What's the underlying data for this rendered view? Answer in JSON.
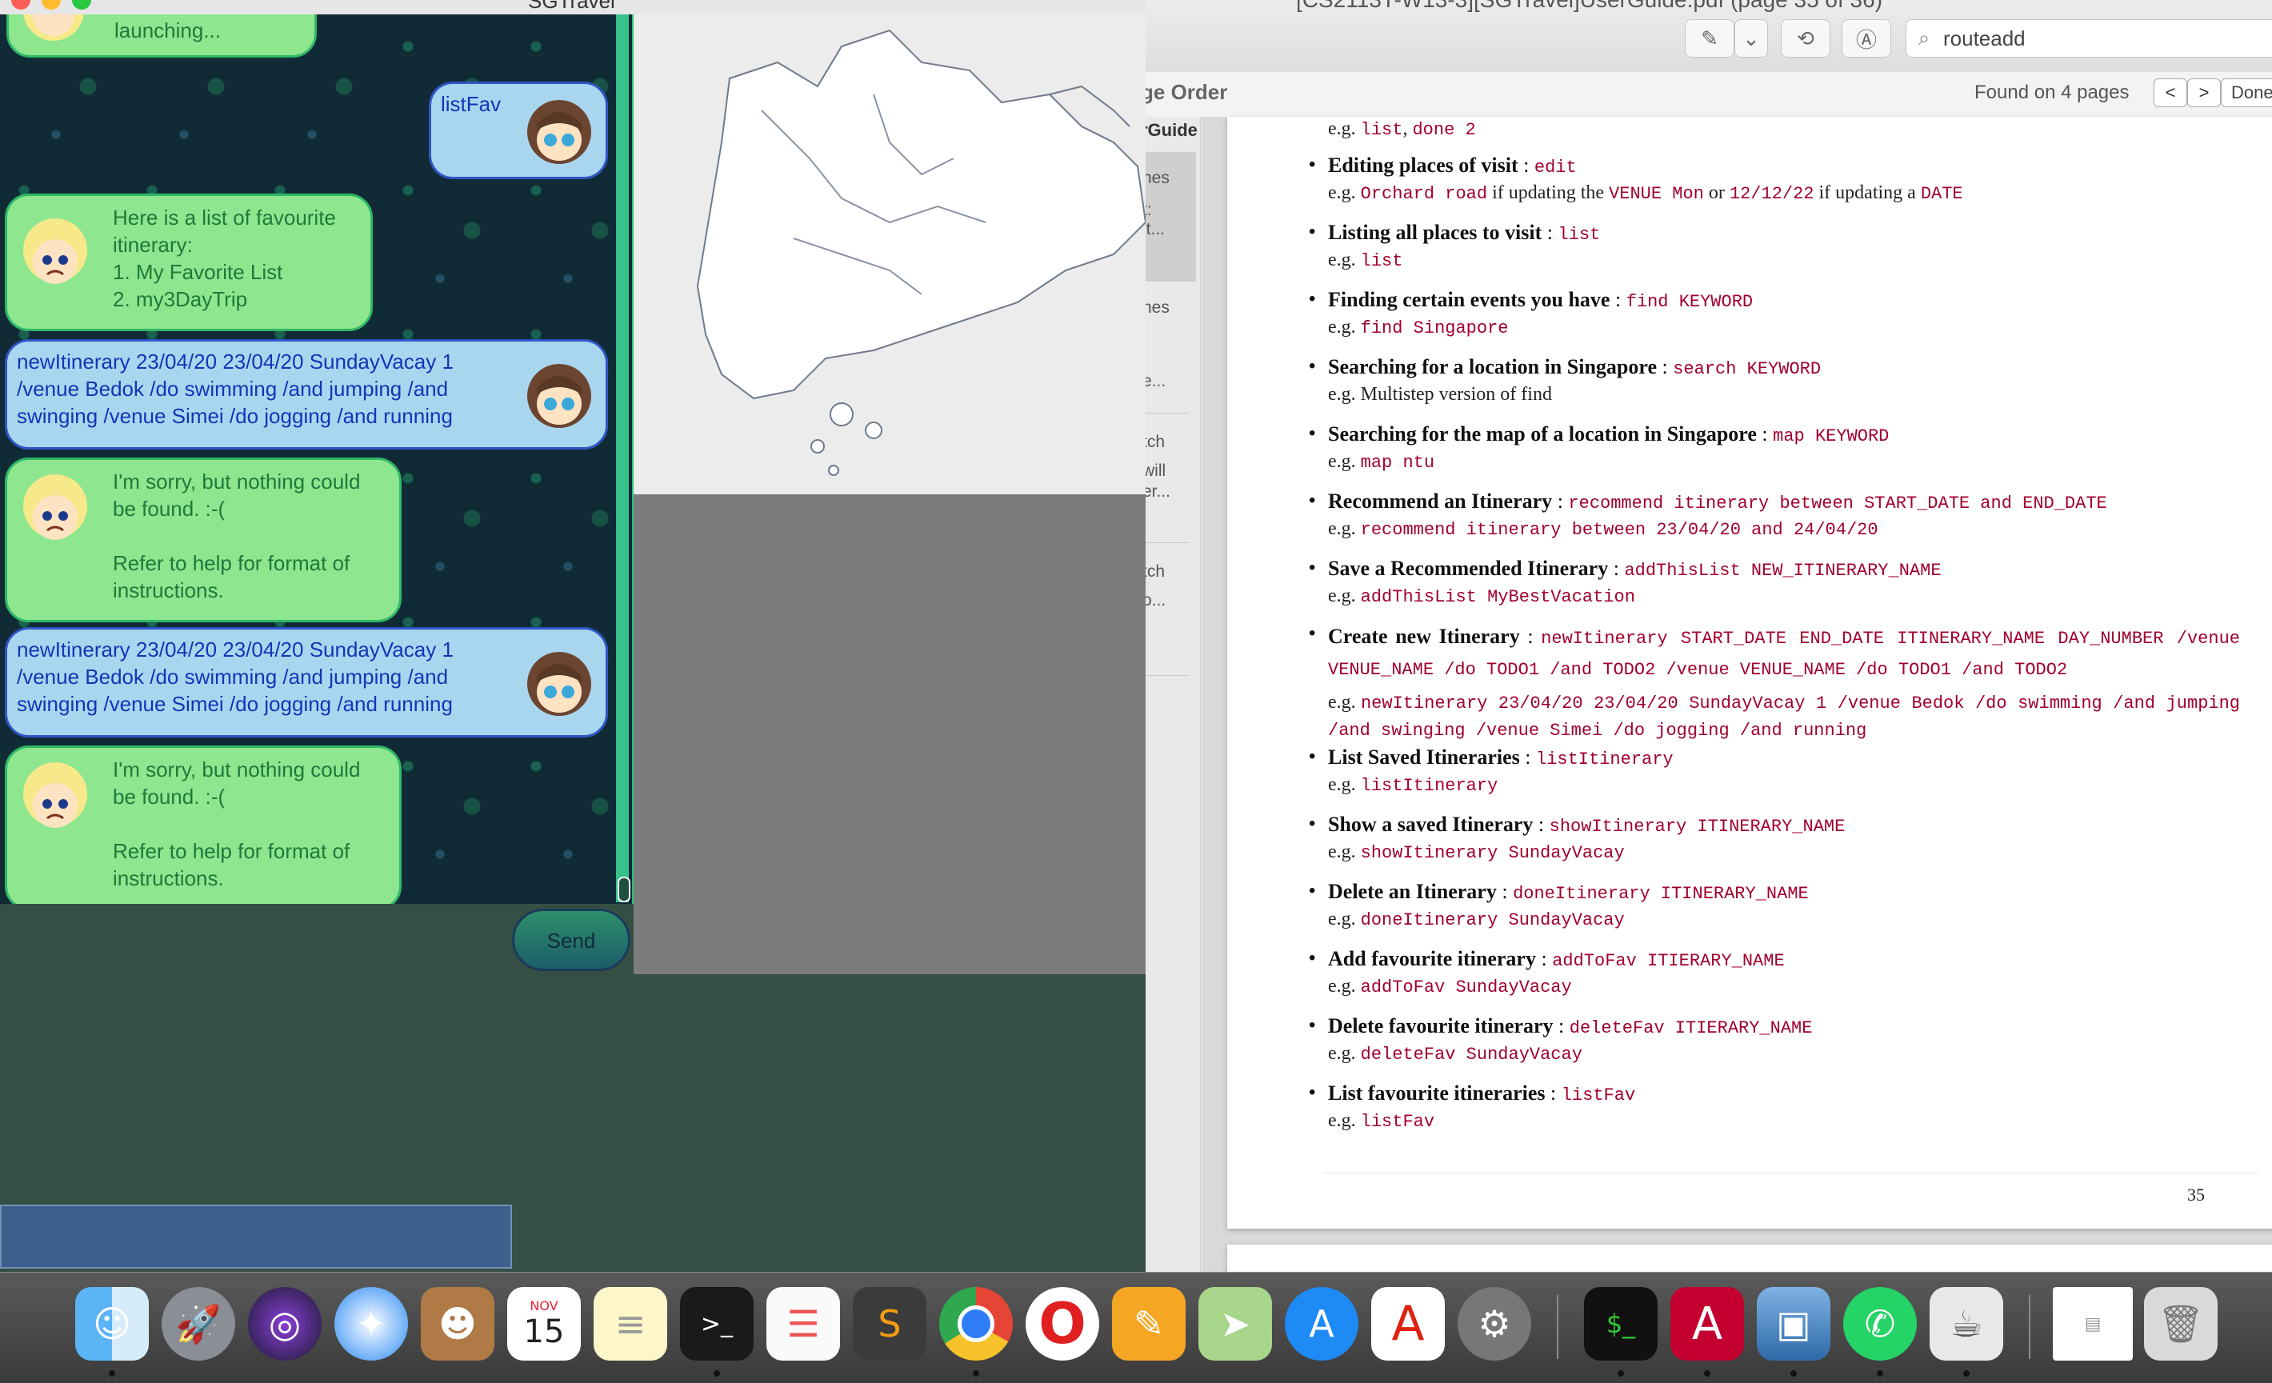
{
  "preview": {
    "window_title": "[CS2113T-W13-3][SGTravel]UserGuide.pdf (page 35 of 36)",
    "search": {
      "value": "routeadd",
      "icon": "magnifier-icon"
    },
    "find_bar": {
      "sort_title": "ge Order",
      "found_text": "Found on 4 pages",
      "prev_label": "<",
      "next_label": ">",
      "done_label": "Done"
    },
    "sidebar": {
      "title": "rGuide",
      "hits": [
        "nes",
        "t:",
        "it...",
        "nes",
        "e...",
        "tch",
        "will",
        "er...",
        "tch",
        "o..."
      ]
    },
    "page_number": "35",
    "items": [
      {
        "head": "",
        "head_cmd": "",
        "ex_prefix": "e.g.",
        "ex_code": "list",
        "ex_text": ", ",
        "ex_code2": "done 2"
      },
      {
        "head": "Editing places of visit",
        "head_cmd": "edit",
        "ex_prefix": "e.g.",
        "ex_code": "Orchard road",
        "ex_text": " if updating the ",
        "ex_code2": "VENUE Mon",
        "ex_text2": " or ",
        "ex_code3": "12/12/22",
        "ex_text3": " if updating a ",
        "ex_code4": "DATE"
      },
      {
        "head": "Listing all places to visit",
        "head_cmd": "list",
        "ex_prefix": "e.g.",
        "ex_code": "list"
      },
      {
        "head": "Finding certain events you have",
        "head_cmd": "find KEYWORD",
        "ex_prefix": "e.g.",
        "ex_code": "find Singapore"
      },
      {
        "head": "Searching for a location in Singapore",
        "head_cmd": "search KEYWORD",
        "ex_prefix": "e.g. Multistep version of find"
      },
      {
        "head": "Searching for the map of a location in Singapore",
        "head_cmd": "map KEYWORD",
        "ex_prefix": "e.g.",
        "ex_code": "map ntu"
      },
      {
        "head": "Recommend an Itinerary",
        "head_cmd": "recommend itinerary between START_DATE and END_DATE",
        "ex_prefix": "e.g.",
        "ex_code": "recommend itinerary between 23/04/20 and 24/04/20"
      },
      {
        "head": "Save a Recommended Itinerary",
        "head_cmd": "addThisList NEW_ITINERARY_NAME",
        "ex_prefix": "e.g.",
        "ex_code": "addThisList MyBestVacation"
      },
      {
        "head": "Create new Itinerary",
        "head_cmd": "newItinerary START_DATE END_DATE ITINERARY_NAME DAY_NUMBER /venue VENUE_NAME /do TODO1 /and TODO2 /venue VENUE_NAME /do TODO1 /and TODO2",
        "ex_prefix": "e.g.",
        "ex_code": "newItinerary 23/04/20 23/04/20 SundayVacay 1 /venue Bedok /do swimming /and jumping /and swinging /venue Simei /do jogging /and running"
      },
      {
        "head": "List Saved Itineraries",
        "head_cmd": "listItinerary",
        "ex_prefix": "e.g.",
        "ex_code": "listItinerary"
      },
      {
        "head": "Show a saved Itinerary",
        "head_cmd": "showItinerary ITINERARY_NAME",
        "ex_prefix": "e.g.",
        "ex_code": "showItinerary SundayVacay"
      },
      {
        "head": "Delete an Itinerary",
        "head_cmd": "doneItinerary ITINERARY_NAME",
        "ex_prefix": "e.g.",
        "ex_code": "doneItinerary SundayVacay"
      },
      {
        "head": "Add favourite itinerary",
        "head_cmd": "addToFav ITIERARY_NAME",
        "ex_prefix": "e.g.",
        "ex_code": "addToFav SundayVacay"
      },
      {
        "head": "Delete favourite itinerary",
        "head_cmd": "deleteFav ITIERARY_NAME",
        "ex_prefix": "e.g.",
        "ex_code": "deleteFav SundayVacay"
      },
      {
        "head": "List favourite itineraries",
        "head_cmd": "listFav",
        "ex_prefix": "e.g.",
        "ex_code": "listFav"
      }
    ]
  },
  "app": {
    "window_title": "SGTravel",
    "top_partial_text": "launching...",
    "messages": [
      {
        "from": "user",
        "text": "listFav"
      },
      {
        "from": "bot",
        "lines": [
          "Here is a list of favourite",
          "itinerary:",
          "1. My Favorite List",
          "2. my3DayTrip"
        ]
      },
      {
        "from": "user",
        "lines": [
          "newItinerary 23/04/20 23/04/20 SundayVacay 1",
          "/venue Bedok /do swimming /and jumping /and",
          "swinging /venue Simei /do jogging /and running"
        ]
      },
      {
        "from": "bot",
        "lines": [
          "I'm sorry, but nothing could",
          "be found. :-(",
          "",
          "Refer to help for format of",
          "instructions."
        ]
      },
      {
        "from": "user",
        "lines": [
          "newItinerary 23/04/20 23/04/20 SundayVacay 1",
          "/venue Bedok /do swimming /and jumping /and",
          "swinging /venue Simei /do jogging /and running"
        ]
      },
      {
        "from": "bot",
        "lines": [
          "I'm sorry, but nothing could",
          "be found. :-(",
          "",
          "Refer to help for format of",
          "instructions."
        ]
      }
    ],
    "send_label": "Send",
    "command_input_value": ""
  },
  "dock": {
    "apps": [
      "finder-icon",
      "launchpad-icon",
      "siri-icon",
      "safari-icon",
      "contacts-icon",
      "calendar-icon",
      "notes-icon",
      "terminal-icon",
      "reminders-icon",
      "sublime-text-icon",
      "chrome-icon",
      "opera-icon",
      "pages-icon",
      "maps-icon",
      "app-store-icon",
      "acrobat-icon",
      "system-preferences-icon",
      "iterm-icon",
      "angular-icon",
      "preview-icon",
      "whatsapp-icon",
      "script-editor-icon",
      "screenshot-thumbnail-icon",
      "trash-icon"
    ],
    "calendar_month": "NOV",
    "calendar_day": "15"
  }
}
